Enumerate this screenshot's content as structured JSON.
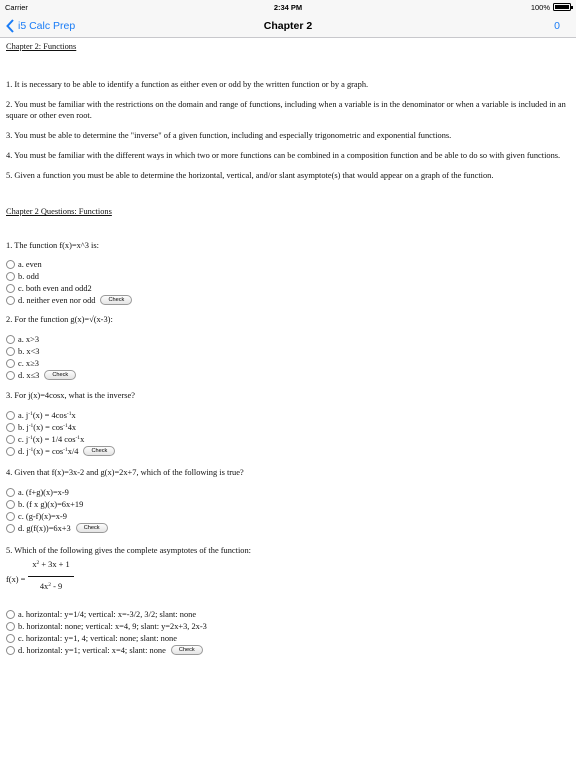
{
  "status_bar": {
    "carrier": "Carrier",
    "time": "2:34 PM",
    "battery": "100%"
  },
  "nav": {
    "back_label": "i5 Calc Prep",
    "title": "Chapter 2",
    "count": "0"
  },
  "chapter": {
    "heading": "Chapter 2: Functions",
    "objectives": [
      "1. It is necessary to be able to identify a function as either even or odd by the written function or by a graph.",
      "2. You must be familiar with the restrictions on the domain and range of functions, including when a variable is in the denominator or when a variable is included in an square or other even root.",
      "3. You must be able to determine the \"inverse\" of a given function, including and especially trigonometric and exponential functions.",
      "4. You must be familiar with the different ways in which two or more functions can be combined in a composition function and be able to do so with given functions.",
      "5. Given a function you must be able to determine the horizontal, vertical, and/or slant asymptote(s) that would appear on a graph of the function."
    ]
  },
  "questions_heading": "Chapter 2 Questions: Functions",
  "check_label": "Check",
  "q1": {
    "text": "1. The function f(x)=x^3 is:",
    "options": [
      "a. even",
      "b. odd",
      "c. both even and odd2",
      "d. neither even nor odd"
    ]
  },
  "q2": {
    "text": "2. For the function g(x)=√(x-3):",
    "options": [
      "a. x>3",
      "b. x<3",
      "c. x≥3",
      "d. x≤3"
    ]
  },
  "q3": {
    "text": "3. For j(x)=4cosx, what is the inverse?",
    "options": [
      {
        "a": "a. j",
        "b": "(x) = 4cos",
        "c": "x"
      },
      {
        "a": "b. j",
        "b": "(x) = cos",
        "c": "4x"
      },
      {
        "a": "c. j",
        "b": "(x) = 1/4 cos",
        "c": "x"
      },
      {
        "a": "d. j",
        "b": "(x) = cos",
        "c": "x/4"
      }
    ],
    "sup": "-1"
  },
  "q4": {
    "text": "4. Given that f(x)=3x-2 and g(x)=2x+7, which of the following is true?",
    "options": [
      "a. (f+g)(x)=x-9",
      "b. (f x g)(x)=6x+19",
      "c. (g-f)(x)=x-9",
      "d. g(f(x))=6x+3"
    ]
  },
  "q5": {
    "text": "5. Which of the following gives the complete asymptotes of the function:",
    "lhs": "f(x) =",
    "num_a": "x",
    "sq": "2",
    "num_b": " + 3x + 1",
    "den_a": "4x",
    "den_b": " - 9",
    "options": [
      "a. horizontal: y=1/4; vertical: x=-3/2, 3/2; slant: none",
      "b. horizontal: none; vertical: x=4, 9; slant: y=2x+3, 2x-3",
      "c. horizontal: y=1, 4; vertical: none; slant: none",
      "d. horizontal: y=1; vertical: x=4; slant: none"
    ]
  },
  "colors": {
    "accent": "#1a7cf6",
    "bar_bg": "#f7f7f7"
  }
}
